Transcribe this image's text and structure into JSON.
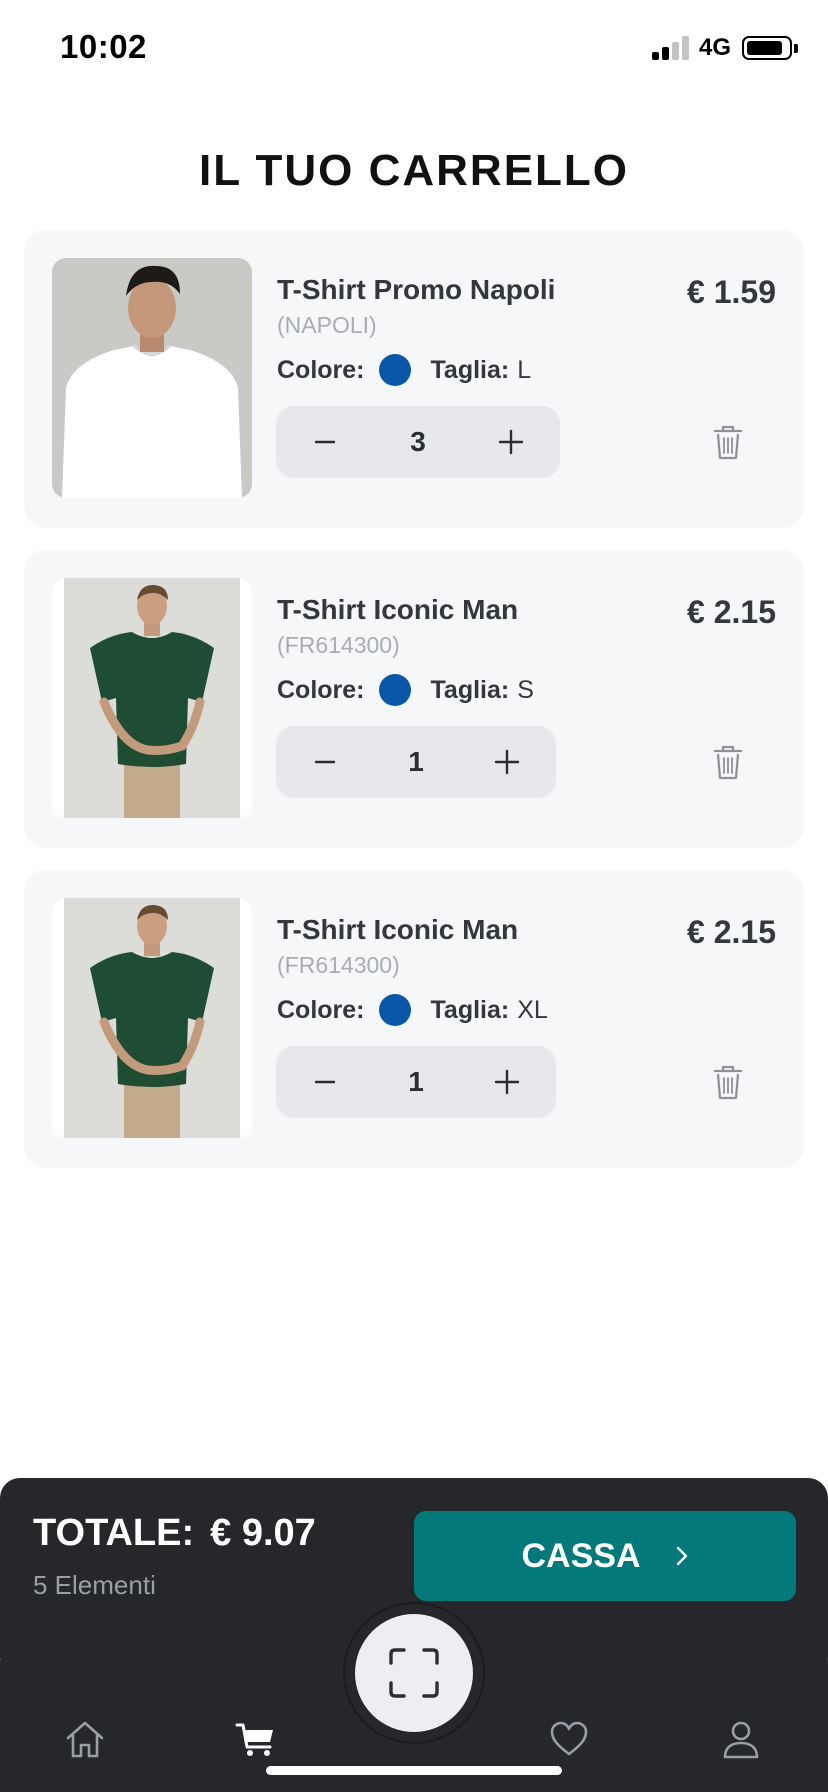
{
  "status_bar": {
    "time": "10:02",
    "network": "4G"
  },
  "page_title": "IL TUO CARRELLO",
  "colors": {
    "accent": "#03797c",
    "dark_bar": "#25272b",
    "swatch_blue": "#0a56a8"
  },
  "labels": {
    "color": "Colore:",
    "size": "Taglia:"
  },
  "cart": [
    {
      "name": "T-Shirt Promo Napoli",
      "code": "(NAPOLI)",
      "price": "€ 1.59",
      "color_hex": "#0a56a8",
      "size": "L",
      "quantity": "3",
      "shirt_color": "#ffffff"
    },
    {
      "name": "T-Shirt Iconic Man",
      "code": "(FR614300)",
      "price": "€ 2.15",
      "color_hex": "#0a56a8",
      "size": "S",
      "quantity": "1",
      "shirt_color": "#1f4d33"
    },
    {
      "name": "T-Shirt Iconic Man",
      "code": "(FR614300)",
      "price": "€ 2.15",
      "color_hex": "#0a56a8",
      "size": "XL",
      "quantity": "1",
      "shirt_color": "#1f4d33"
    }
  ],
  "summary": {
    "total_label": "TOTALE:",
    "total_amount": "€ 9.07",
    "items_count": "5 Elementi"
  },
  "checkout": {
    "label": "CASSA",
    "chevron": "›"
  },
  "tab_bar": {
    "items": [
      {
        "name": "home",
        "icon": "home-icon"
      },
      {
        "name": "cart",
        "icon": "cart-icon"
      },
      {
        "name": "scan",
        "icon": "scan-icon"
      },
      {
        "name": "favorites",
        "icon": "heart-icon"
      },
      {
        "name": "profile",
        "icon": "user-icon"
      }
    ]
  }
}
